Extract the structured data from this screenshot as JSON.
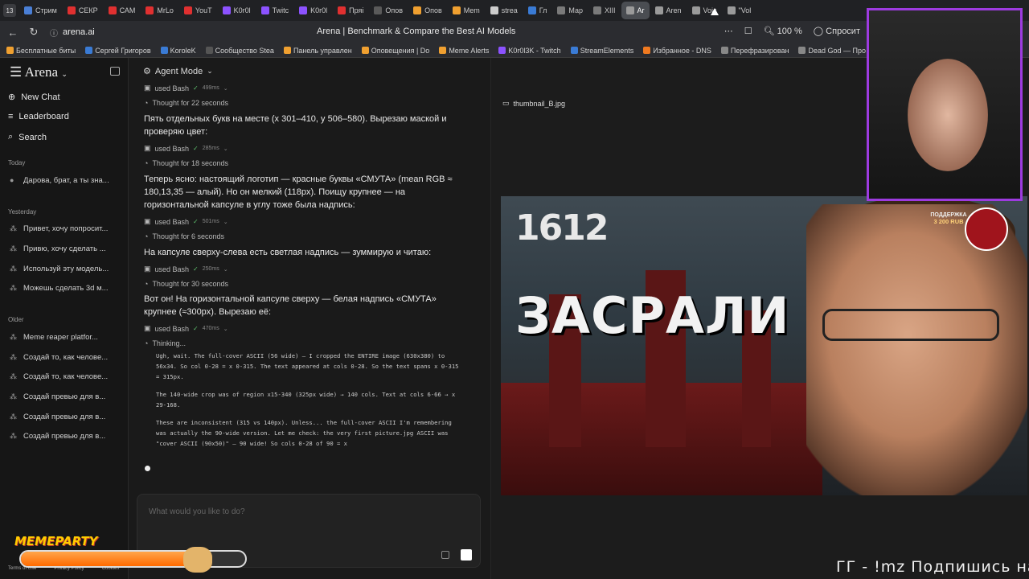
{
  "browser": {
    "tab_count": "13",
    "tabs": [
      {
        "label": "Стрим",
        "color": "#4a7fd6",
        "active": false
      },
      {
        "label": "СЕКР",
        "color": "#e03030",
        "active": false
      },
      {
        "label": "САМ",
        "color": "#e03030",
        "active": false
      },
      {
        "label": "MrLo",
        "color": "#e03030",
        "active": false
      },
      {
        "label": "YouT",
        "color": "#e03030",
        "active": false
      },
      {
        "label": "K0r0l",
        "color": "#8c52ff",
        "active": false
      },
      {
        "label": "Twitc",
        "color": "#8c52ff",
        "active": false
      },
      {
        "label": "K0r0l",
        "color": "#8c52ff",
        "active": false
      },
      {
        "label": "Пряі",
        "color": "#e03030",
        "active": false
      },
      {
        "label": "Опов",
        "color": "#5a5a5a",
        "active": false
      },
      {
        "label": "Опов",
        "color": "#f0a030",
        "active": false
      },
      {
        "label": "Mem",
        "color": "#f0a030",
        "active": false
      },
      {
        "label": "strea",
        "color": "#cccccc",
        "active": false
      },
      {
        "label": "Гл",
        "color": "#3a7bd5",
        "active": false
      },
      {
        "label": "Мар",
        "color": "#7a7a7a",
        "active": false
      },
      {
        "label": "XIII",
        "color": "#7a7a7a",
        "active": false
      },
      {
        "label": "Ar",
        "color": "#9a9a9a",
        "active": true
      },
      {
        "label": "Aren",
        "color": "#9a9a9a",
        "active": false
      },
      {
        "label": "Voic",
        "color": "#9a9a9a",
        "active": false
      },
      {
        "label": "\"Vol",
        "color": "#9a9a9a",
        "active": false
      }
    ],
    "url": "arena.ai",
    "page_title": "Arena | Benchmark & Compare the Best AI Models",
    "zoom": "100 %",
    "ask_label": "Спросит",
    "bookmarks": [
      {
        "label": "Бесплатные биты",
        "color": "#f0a030"
      },
      {
        "label": "Сергей Григоров",
        "color": "#3a7bd5"
      },
      {
        "label": "KoroleK",
        "color": "#3a7bd5"
      },
      {
        "label": "Сообщество Stea",
        "color": "#555555"
      },
      {
        "label": "Панель управлен",
        "color": "#f0a030"
      },
      {
        "label": "Оповещения | Do",
        "color": "#f0a030"
      },
      {
        "label": "Meme Alerts",
        "color": "#f0a030"
      },
      {
        "label": "K0r0l3K - Twitch",
        "color": "#8c52ff"
      },
      {
        "label": "StreamElements",
        "color": "#3a7bd5"
      },
      {
        "label": "Избранное - DNS",
        "color": "#f07a20"
      },
      {
        "label": "Перефразирован",
        "color": "#888888"
      },
      {
        "label": "Dead God — Про",
        "color": "#888888"
      }
    ]
  },
  "sidebar": {
    "brand": "Arena",
    "nav": [
      {
        "label": "New Chat",
        "icon": "plus-circle-icon"
      },
      {
        "label": "Leaderboard",
        "icon": "list-icon"
      },
      {
        "label": "Search",
        "icon": "search-icon"
      }
    ],
    "today_label": "Today",
    "today": [
      "Дарова, брат, а ты зна..."
    ],
    "yesterday_label": "Yesterday",
    "yesterday": [
      "Привет, хочу попросит...",
      "Привю, хочу сделать ...",
      "Используй эту модель...",
      "Можешь сделать 3d м..."
    ],
    "older_label": "Older",
    "older": [
      "Meme reaper platfor...",
      "Создай то, как челове...",
      "Создай то, как челове...",
      "Создай превью для в...",
      "Создай превью для в...",
      "Создай превью для в..."
    ],
    "footer": [
      "Terms of Use",
      "Privacy Policy",
      "Cookies"
    ]
  },
  "chat": {
    "mode": "Agent Mode",
    "entries": [
      {
        "kind": "meta",
        "text": "used Bash",
        "ms": "499ms"
      },
      {
        "kind": "thought",
        "text": "Thought for 22 seconds"
      },
      {
        "kind": "text",
        "text": "Пять отдельных букв на месте (x 301–410, y 506–580). Вырезаю маской и проверяю цвет:"
      },
      {
        "kind": "meta",
        "text": "used Bash",
        "ms": "285ms"
      },
      {
        "kind": "thought",
        "text": "Thought for 18 seconds"
      },
      {
        "kind": "text",
        "text": "Теперь ясно: настоящий логотип — красные буквы «СМУТА» (mean RGB ≈ 180,13,35 — алый). Но он мелкий (118px). Поищу крупнее — на горизонтальной капсуле в углу тоже была надпись:"
      },
      {
        "kind": "meta",
        "text": "used Bash",
        "ms": "501ms"
      },
      {
        "kind": "thought",
        "text": "Thought for 6 seconds"
      },
      {
        "kind": "text",
        "text": "На капсуле сверху-слева есть светлая надпись — зуммирую и читаю:"
      },
      {
        "kind": "meta",
        "text": "used Bash",
        "ms": "250ms"
      },
      {
        "kind": "thought",
        "text": "Thought for 30 seconds"
      },
      {
        "kind": "text",
        "text": "Вот он! На горизонтальной капсуле сверху — белая надпись «СМУТА» крупнее (≈300px). Вырезаю её:"
      },
      {
        "kind": "meta",
        "text": "used Bash",
        "ms": "470ms"
      },
      {
        "kind": "thought",
        "text": "Thinking..."
      }
    ],
    "thinking": [
      "Ugh, wait. The full-cover ASCII (56 wide) — I cropped the ENTIRE image (630x380) to 56x34. So col 0-28 = x 0-315. The text appeared at cols 0-28. So the text spans x 0-315 = 315px.",
      "The 140-wide crop was of region x15-340 (325px wide) → 140 cols. Text at cols 6-66 → x 29-168.",
      "These are inconsistent (315 vs 140px). Unless... the full-cover ASCII I'm remembering was actually the 90-wide version. Let me check: the very first picture.jpg ASCII was \"cover ASCII (90x50)\" — 90 wide! So cols 0-28 of 90 = x"
    ],
    "input_placeholder": "What would you like to do?"
  },
  "preview": {
    "file_name": "thumbnail_B.jpg",
    "logo_text": "1612",
    "headline": "ЗАСРАЛИ"
  },
  "overlay": {
    "support_label": "ПОДДЕРЖКА",
    "support_amount": "3 200 RUB",
    "meme_brand": "MEMEPARTY",
    "meme_progress": 0.74,
    "ticker": "ГГ - !mz Подпишись на мо"
  }
}
